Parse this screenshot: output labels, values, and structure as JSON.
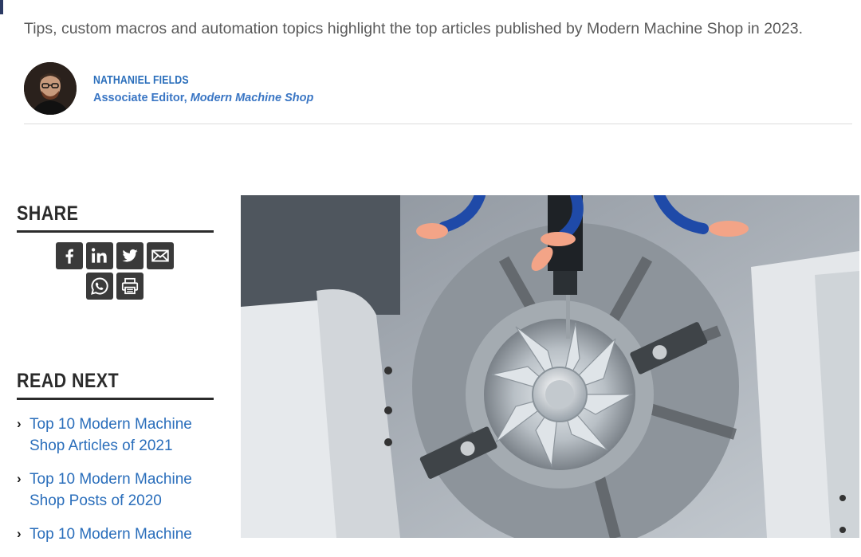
{
  "article": {
    "subtitle": "Tips, custom macros and automation topics highlight the top articles published by Modern Machine Shop in 2023."
  },
  "author": {
    "name": "NATHANIEL FIELDS",
    "role_prefix": "Associate Editor, ",
    "role_publication": "Modern Machine Shop"
  },
  "share": {
    "heading": "SHARE",
    "buttons": [
      {
        "icon": "facebook-icon"
      },
      {
        "icon": "linkedin-icon"
      },
      {
        "icon": "twitter-icon"
      },
      {
        "icon": "email-icon"
      },
      {
        "icon": "whatsapp-icon"
      },
      {
        "icon": "print-icon"
      }
    ]
  },
  "read_next": {
    "heading": "READ NEXT",
    "items": [
      {
        "title": "Top 10 Modern Machine Shop Articles of 2021"
      },
      {
        "title": "Top 10 Modern Machine Shop Posts of 2020"
      },
      {
        "title": "Top 10 Modern Machine"
      }
    ]
  },
  "colors": {
    "link": "#2a6ebb",
    "heading": "#2b2b2b",
    "icon_bg": "#3a3a3a"
  }
}
